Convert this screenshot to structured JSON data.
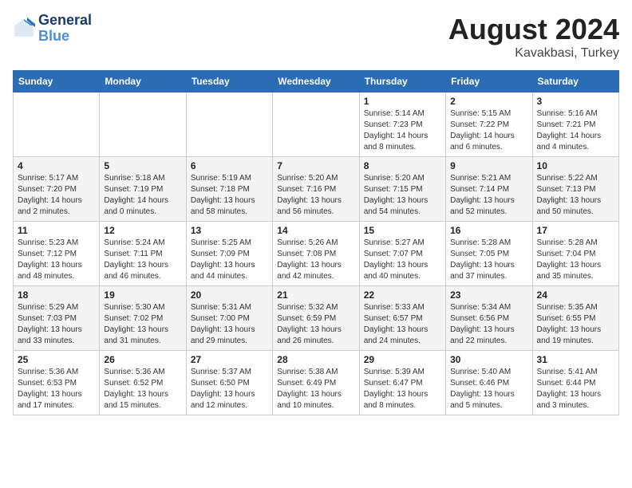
{
  "header": {
    "logo_line1": "General",
    "logo_line2": "Blue",
    "month": "August 2024",
    "location": "Kavakbasi, Turkey"
  },
  "weekdays": [
    "Sunday",
    "Monday",
    "Tuesday",
    "Wednesday",
    "Thursday",
    "Friday",
    "Saturday"
  ],
  "weeks": [
    [
      {
        "day": "",
        "info": ""
      },
      {
        "day": "",
        "info": ""
      },
      {
        "day": "",
        "info": ""
      },
      {
        "day": "",
        "info": ""
      },
      {
        "day": "1",
        "info": "Sunrise: 5:14 AM\nSunset: 7:23 PM\nDaylight: 14 hours\nand 8 minutes."
      },
      {
        "day": "2",
        "info": "Sunrise: 5:15 AM\nSunset: 7:22 PM\nDaylight: 14 hours\nand 6 minutes."
      },
      {
        "day": "3",
        "info": "Sunrise: 5:16 AM\nSunset: 7:21 PM\nDaylight: 14 hours\nand 4 minutes."
      }
    ],
    [
      {
        "day": "4",
        "info": "Sunrise: 5:17 AM\nSunset: 7:20 PM\nDaylight: 14 hours\nand 2 minutes."
      },
      {
        "day": "5",
        "info": "Sunrise: 5:18 AM\nSunset: 7:19 PM\nDaylight: 14 hours\nand 0 minutes."
      },
      {
        "day": "6",
        "info": "Sunrise: 5:19 AM\nSunset: 7:18 PM\nDaylight: 13 hours\nand 58 minutes."
      },
      {
        "day": "7",
        "info": "Sunrise: 5:20 AM\nSunset: 7:16 PM\nDaylight: 13 hours\nand 56 minutes."
      },
      {
        "day": "8",
        "info": "Sunrise: 5:20 AM\nSunset: 7:15 PM\nDaylight: 13 hours\nand 54 minutes."
      },
      {
        "day": "9",
        "info": "Sunrise: 5:21 AM\nSunset: 7:14 PM\nDaylight: 13 hours\nand 52 minutes."
      },
      {
        "day": "10",
        "info": "Sunrise: 5:22 AM\nSunset: 7:13 PM\nDaylight: 13 hours\nand 50 minutes."
      }
    ],
    [
      {
        "day": "11",
        "info": "Sunrise: 5:23 AM\nSunset: 7:12 PM\nDaylight: 13 hours\nand 48 minutes."
      },
      {
        "day": "12",
        "info": "Sunrise: 5:24 AM\nSunset: 7:11 PM\nDaylight: 13 hours\nand 46 minutes."
      },
      {
        "day": "13",
        "info": "Sunrise: 5:25 AM\nSunset: 7:09 PM\nDaylight: 13 hours\nand 44 minutes."
      },
      {
        "day": "14",
        "info": "Sunrise: 5:26 AM\nSunset: 7:08 PM\nDaylight: 13 hours\nand 42 minutes."
      },
      {
        "day": "15",
        "info": "Sunrise: 5:27 AM\nSunset: 7:07 PM\nDaylight: 13 hours\nand 40 minutes."
      },
      {
        "day": "16",
        "info": "Sunrise: 5:28 AM\nSunset: 7:05 PM\nDaylight: 13 hours\nand 37 minutes."
      },
      {
        "day": "17",
        "info": "Sunrise: 5:28 AM\nSunset: 7:04 PM\nDaylight: 13 hours\nand 35 minutes."
      }
    ],
    [
      {
        "day": "18",
        "info": "Sunrise: 5:29 AM\nSunset: 7:03 PM\nDaylight: 13 hours\nand 33 minutes."
      },
      {
        "day": "19",
        "info": "Sunrise: 5:30 AM\nSunset: 7:02 PM\nDaylight: 13 hours\nand 31 minutes."
      },
      {
        "day": "20",
        "info": "Sunrise: 5:31 AM\nSunset: 7:00 PM\nDaylight: 13 hours\nand 29 minutes."
      },
      {
        "day": "21",
        "info": "Sunrise: 5:32 AM\nSunset: 6:59 PM\nDaylight: 13 hours\nand 26 minutes."
      },
      {
        "day": "22",
        "info": "Sunrise: 5:33 AM\nSunset: 6:57 PM\nDaylight: 13 hours\nand 24 minutes."
      },
      {
        "day": "23",
        "info": "Sunrise: 5:34 AM\nSunset: 6:56 PM\nDaylight: 13 hours\nand 22 minutes."
      },
      {
        "day": "24",
        "info": "Sunrise: 5:35 AM\nSunset: 6:55 PM\nDaylight: 13 hours\nand 19 minutes."
      }
    ],
    [
      {
        "day": "25",
        "info": "Sunrise: 5:36 AM\nSunset: 6:53 PM\nDaylight: 13 hours\nand 17 minutes."
      },
      {
        "day": "26",
        "info": "Sunrise: 5:36 AM\nSunset: 6:52 PM\nDaylight: 13 hours\nand 15 minutes."
      },
      {
        "day": "27",
        "info": "Sunrise: 5:37 AM\nSunset: 6:50 PM\nDaylight: 13 hours\nand 12 minutes."
      },
      {
        "day": "28",
        "info": "Sunrise: 5:38 AM\nSunset: 6:49 PM\nDaylight: 13 hours\nand 10 minutes."
      },
      {
        "day": "29",
        "info": "Sunrise: 5:39 AM\nSunset: 6:47 PM\nDaylight: 13 hours\nand 8 minutes."
      },
      {
        "day": "30",
        "info": "Sunrise: 5:40 AM\nSunset: 6:46 PM\nDaylight: 13 hours\nand 5 minutes."
      },
      {
        "day": "31",
        "info": "Sunrise: 5:41 AM\nSunset: 6:44 PM\nDaylight: 13 hours\nand 3 minutes."
      }
    ]
  ]
}
